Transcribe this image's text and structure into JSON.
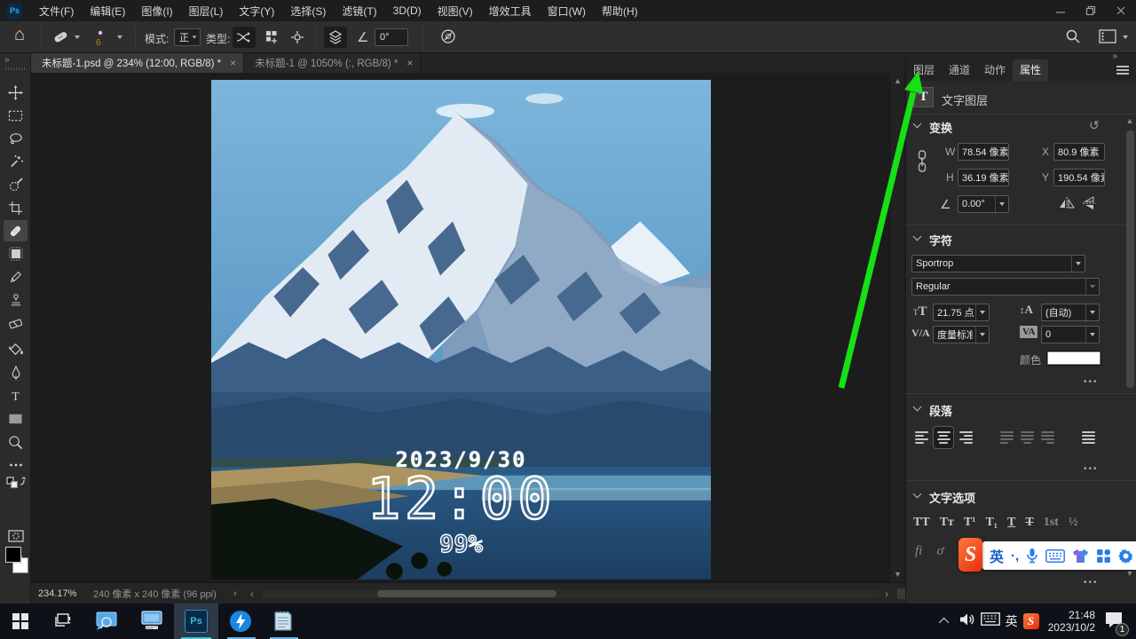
{
  "titlebar": {
    "logo": "Ps",
    "menus": [
      "文件(F)",
      "编辑(E)",
      "图像(I)",
      "图层(L)",
      "文字(Y)",
      "选择(S)",
      "滤镜(T)",
      "3D(D)",
      "视图(V)",
      "增效工具",
      "窗口(W)",
      "帮助(H)"
    ]
  },
  "options_bar": {
    "brush_size": "6",
    "mode_label": "模式:",
    "mode_value": "正",
    "type_label": "类型:",
    "angle_value": "0°"
  },
  "document_tabs": [
    {
      "title": "未标题-1.psd @ 234% (12:00, RGB/8) *"
    },
    {
      "title": "未标题-1 @ 1050% (:, RGB/8) *"
    }
  ],
  "canvas": {
    "date": "2023/9/30",
    "time": "12:00",
    "percent": "99%"
  },
  "panel": {
    "tabs": [
      "图层",
      "通道",
      "动作",
      "属性"
    ],
    "layer_badge": "T",
    "layer_type": "文字图层",
    "transform": {
      "title": "变换",
      "w_label": "W",
      "w_value": "78.54 像素",
      "x_label": "X",
      "x_value": "80.9 像素",
      "h_label": "H",
      "h_value": "36.19 像素",
      "y_label": "Y",
      "y_value": "190.54 像素",
      "angle_value": "0.00°"
    },
    "character": {
      "title": "字符",
      "font_family": "Sportrop",
      "font_style": "Regular",
      "size_icon": "T",
      "size_value": "21.75 点",
      "leading_value": "(自动)",
      "kerning_icon": "V/A",
      "kerning_value": "度量标准",
      "tracking_icon": "VA",
      "tracking_value": "0",
      "color_label": "颜色",
      "color_value": "#ffffff"
    },
    "paragraph": {
      "title": "段落"
    },
    "type_options": {
      "title": "文字选项",
      "features": [
        "TT",
        "Tᴛ",
        "T¹",
        "T₁",
        "T",
        "T",
        "1st",
        "½"
      ],
      "fi": "fi",
      "swash": "ơ"
    }
  },
  "status_bar": {
    "zoom": "234.17%",
    "dimensions": "240 像素 x 240 像素 (96 ppi)"
  },
  "sogou": {
    "logo": "S",
    "lang": "英",
    "punct": "·,"
  },
  "taskbar": {
    "ps": "Ps",
    "lang": "英",
    "time": "21:48",
    "date": "2023/10/2",
    "badge": "1"
  },
  "icons": {
    "close": "×",
    "collapse": "»",
    "home": "⌂",
    "reset": "↺",
    "angle": "∠",
    "more": "•••",
    "prev": "‹",
    "next": "›",
    "up": "▲",
    "down": "▼"
  },
  "colors": {
    "accent_green": "#16e016",
    "sogou_red": "#e8340c",
    "ps_blue": "#31a8ff"
  }
}
